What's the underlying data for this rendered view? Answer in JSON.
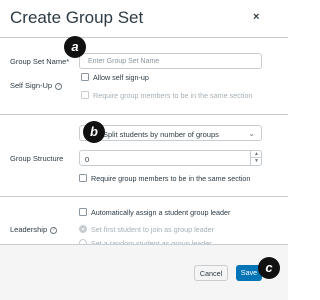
{
  "dialog": {
    "title": "Create Group Set",
    "close_glyph": "×"
  },
  "group_set_name": {
    "label": "Group Set Name*",
    "placeholder": "Enter Group Set Name",
    "value": ""
  },
  "self_signup": {
    "label": "Self Sign-Up",
    "help_glyph": "?",
    "allow_label": "Allow self sign-up",
    "allow_checked": false,
    "require_label": "Require group members to be in the same section",
    "require_checked": false
  },
  "group_structure": {
    "label": "Group Structure",
    "select_value": "Split students by number of groups",
    "number_value": "0",
    "require_label": "Require group members to be in the same section",
    "require_checked": false
  },
  "leadership": {
    "label": "Leadership",
    "help_glyph": "?",
    "auto_assign_label": "Automatically assign a student group leader",
    "auto_assign_checked": false,
    "option_first": "Set first student to join as group leader",
    "option_random": "Set a random student as group leader",
    "selected_option": "first"
  },
  "footer": {
    "cancel_label": "Cancel",
    "save_label": "Save"
  },
  "markers": [
    "a",
    "b",
    "c"
  ],
  "icons": {
    "close": "close-icon",
    "help": "help-circle-icon",
    "chevron": "chevron-down-icon",
    "stepper_up": "chevron-up-icon",
    "stepper_down": "chevron-down-icon"
  },
  "colors": {
    "primary": "#0374b5",
    "text": "#2d3b45",
    "border": "#c7cdd1",
    "footer_bg": "#f5f5f5",
    "marker_bg": "#111111"
  }
}
